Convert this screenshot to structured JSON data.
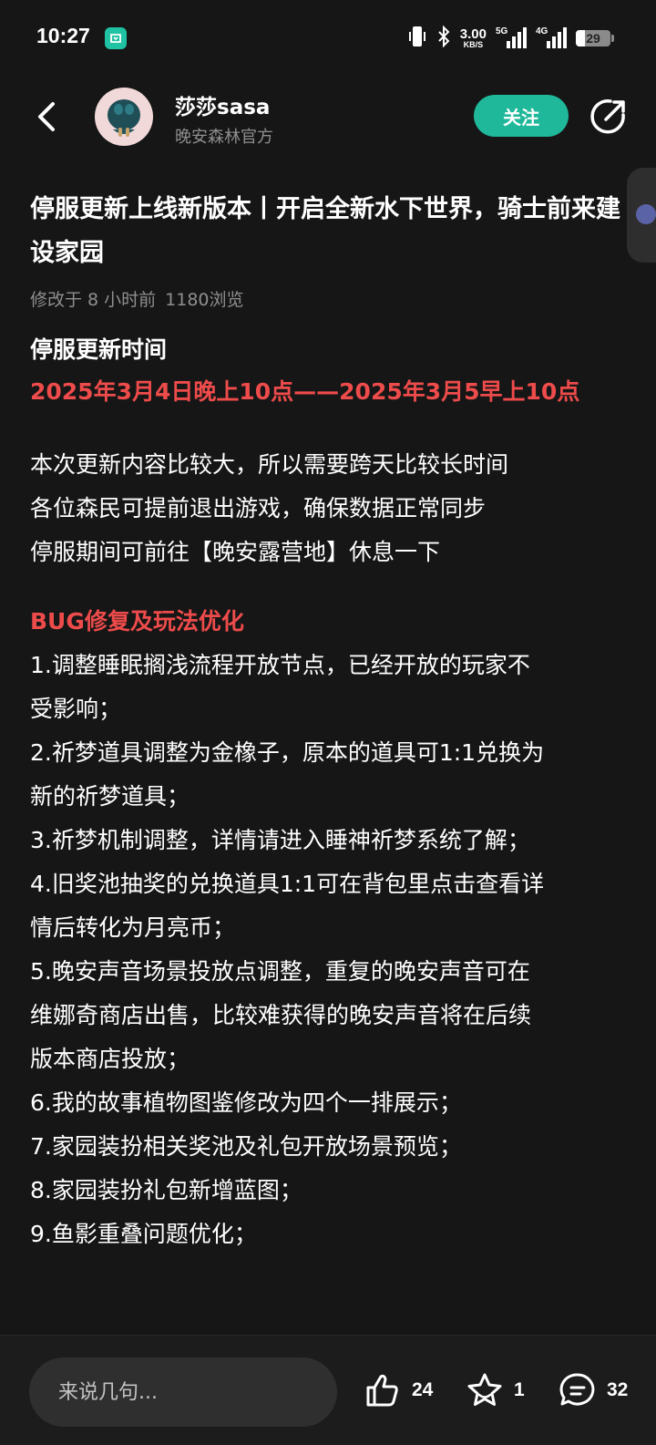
{
  "status_bar": {
    "time": "10:27",
    "net_speed": "3.00",
    "net_unit": "KB/S",
    "sim1_tag": "5G",
    "sim2_tag": "4G",
    "battery": "29"
  },
  "header": {
    "author_name": "莎莎sasa",
    "author_subtitle": "晚安森林官方",
    "follow_label": "关注"
  },
  "post": {
    "title": "停服更新上线新版本丨开启全新水下世界，骑士前来建设家园",
    "meta_time": "修改于 8 小时前",
    "meta_views": "1180浏览",
    "section1_heading": "停服更新时间",
    "maintenance_time": "2025年3月4日晚上10点——2025年3月5早上10点",
    "intro_lines": [
      "本次更新内容比较大，所以需要跨天比较长时间",
      "各位森民可提前退出游戏，确保数据正常同步",
      "停服期间可前往【晚安露营地】休息一下"
    ],
    "bug_heading": "BUG修复及玩法优化",
    "fix_lines": [
      "1.调整睡眠搁浅流程开放节点，已经开放的玩家不",
      "受影响；",
      "2.祈梦道具调整为金橡子，原本的道具可1:1兑换为",
      "新的祈梦道具；",
      "3.祈梦机制调整，详情请进入睡神祈梦系统了解；",
      "4.旧奖池抽奖的兑换道具1:1可在背包里点击查看详",
      "情后转化为月亮币；",
      "5.晚安声音场景投放点调整，重复的晚安声音可在",
      "维娜奇商店出售，比较难获得的晚安声音将在后续",
      "版本商店投放；",
      "6.我的故事植物图鉴修改为四个一排展示；",
      "7.家园装扮相关奖池及礼包开放场景预览；",
      "8.家园装扮礼包新增蓝图；",
      "9.鱼影重叠问题优化；"
    ]
  },
  "bottom_bar": {
    "comment_placeholder": "来说几句...",
    "like_count": "24",
    "favorite_count": "1",
    "comment_count": "32"
  },
  "colors": {
    "background": "#161616",
    "accent_teal": "#1fb89a",
    "highlight_red": "#ee4b4b",
    "muted_text": "#8f8f8f"
  }
}
